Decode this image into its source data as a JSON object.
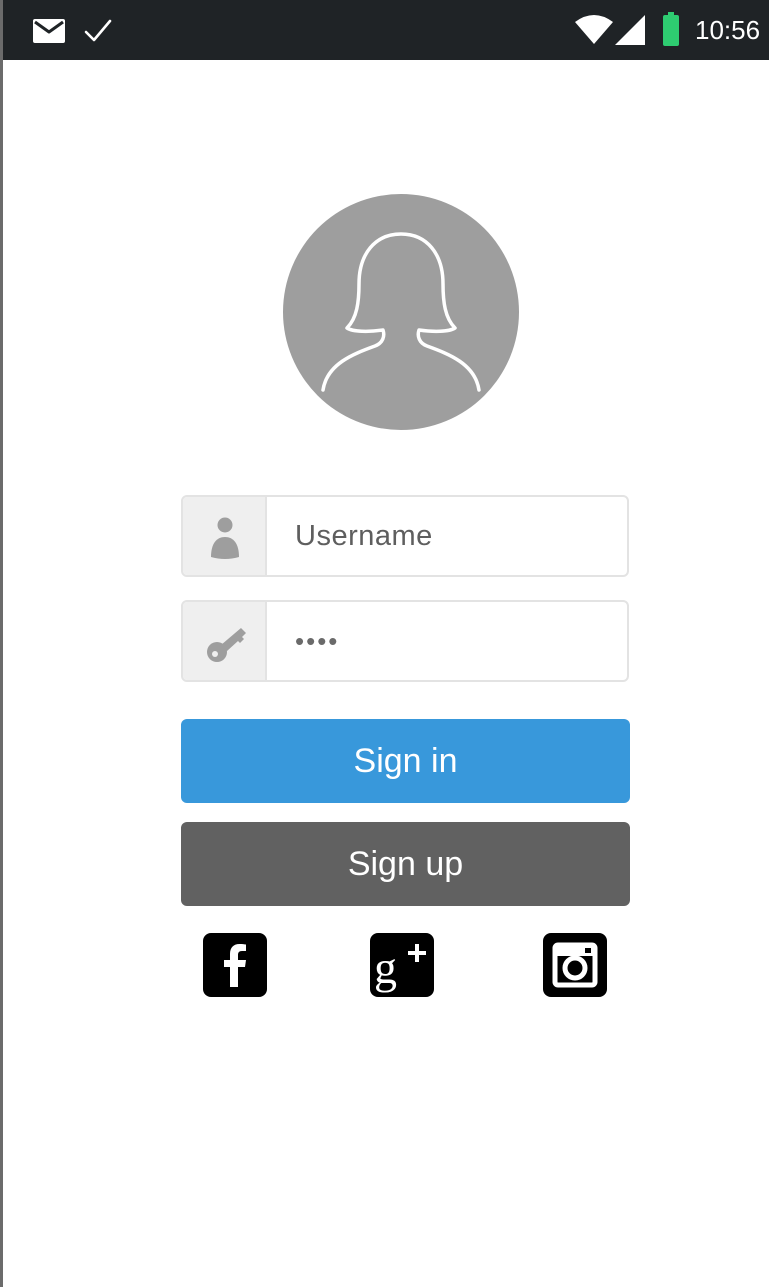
{
  "status_bar": {
    "time": "10:56",
    "icons": [
      "mail-icon",
      "check-icon",
      "wifi-icon",
      "cell-signal-icon",
      "battery-icon"
    ],
    "battery_color": "#2ecc71"
  },
  "profile": {
    "avatar_icon": "female-user-silhouette-icon",
    "avatar_bg": "#9e9e9e"
  },
  "login_form": {
    "username": {
      "icon": "user-icon",
      "placeholder": "Username",
      "value": ""
    },
    "password": {
      "icon": "key-icon",
      "value": "••••"
    },
    "sign_in_label": "Sign in",
    "sign_up_label": "Sign up",
    "sign_in_color": "#3898db",
    "sign_up_color": "#616161"
  },
  "social_login": {
    "items": [
      {
        "name": "facebook",
        "icon": "facebook-icon"
      },
      {
        "name": "google-plus",
        "icon": "google-plus-icon"
      },
      {
        "name": "instagram",
        "icon": "instagram-icon"
      }
    ]
  }
}
